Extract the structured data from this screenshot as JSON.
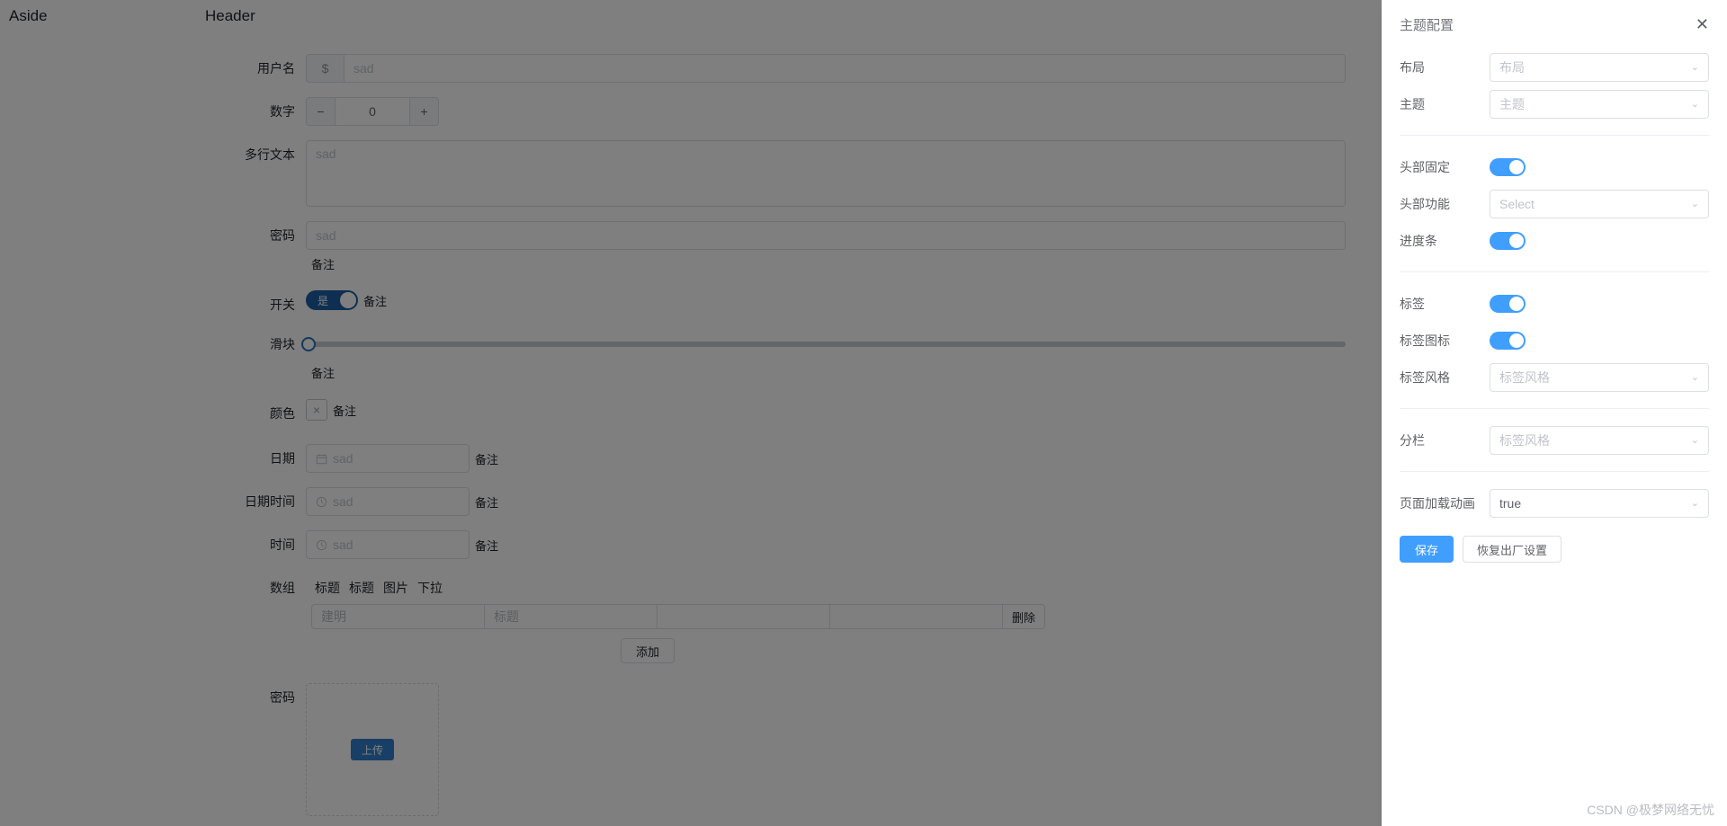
{
  "page": {
    "aside_label": "Aside",
    "header_label": "Header"
  },
  "form": {
    "username": {
      "label": "用户名",
      "prepend": "$",
      "placeholder": "sad"
    },
    "number": {
      "label": "数字",
      "minus": "−",
      "plus": "+",
      "value": "0"
    },
    "textarea": {
      "label": "多行文本",
      "placeholder": "sad"
    },
    "password": {
      "label": "密码",
      "placeholder": "sad",
      "hint": "备注"
    },
    "switch": {
      "label": "开关",
      "on_text": "是",
      "hint": "备注"
    },
    "slider": {
      "label": "滑块",
      "hint": "备注"
    },
    "color": {
      "label": "颜色",
      "icon_glyph": "×",
      "hint": "备注"
    },
    "date": {
      "label": "日期",
      "placeholder": "sad",
      "hint": "备注"
    },
    "datetime": {
      "label": "日期时间",
      "placeholder": "sad",
      "hint": "备注"
    },
    "time": {
      "label": "时间",
      "placeholder": "sad",
      "hint": "备注"
    },
    "array": {
      "label": "数组",
      "columns": [
        "标题",
        "标题",
        "图片",
        "下拉"
      ],
      "rows": [
        {
          "cells": [
            "建明",
            "标题",
            "",
            ""
          ],
          "delete_label": "删除"
        }
      ],
      "add_label": "添加"
    },
    "upload": {
      "label": "密码",
      "button_label": "上传"
    }
  },
  "drawer": {
    "title": "主题配置",
    "close_glyph": "✕",
    "groups": [
      {
        "rows": [
          {
            "type": "select",
            "label": "布局",
            "value": "布局",
            "placeholder": true
          },
          {
            "type": "select",
            "label": "主题",
            "value": "主题",
            "placeholder": true
          }
        ]
      },
      {
        "rows": [
          {
            "type": "switch",
            "label": "头部固定",
            "on": true
          },
          {
            "type": "select",
            "label": "头部功能",
            "value": "Select",
            "placeholder": true
          },
          {
            "type": "switch",
            "label": "进度条",
            "on": true
          }
        ]
      },
      {
        "rows": [
          {
            "type": "switch",
            "label": "标签",
            "on": true
          },
          {
            "type": "switch",
            "label": "标签图标",
            "on": true
          },
          {
            "type": "select",
            "label": "标签风格",
            "value": "标签风格",
            "placeholder": true
          }
        ]
      },
      {
        "rows": [
          {
            "type": "select",
            "label": "分栏",
            "value": "标签风格",
            "placeholder": true
          }
        ]
      },
      {
        "rows": [
          {
            "type": "select",
            "label": "页面加载动画",
            "value": "true",
            "placeholder": false
          }
        ]
      }
    ],
    "save_label": "保存",
    "reset_label": "恢复出厂设置"
  },
  "watermark": "CSDN @极梦网络无忧",
  "colors": {
    "primary": "#409eff",
    "switch_on_page": "#1d5fa4",
    "border": "#dcdfe6",
    "placeholder": "#c0c4cc"
  }
}
